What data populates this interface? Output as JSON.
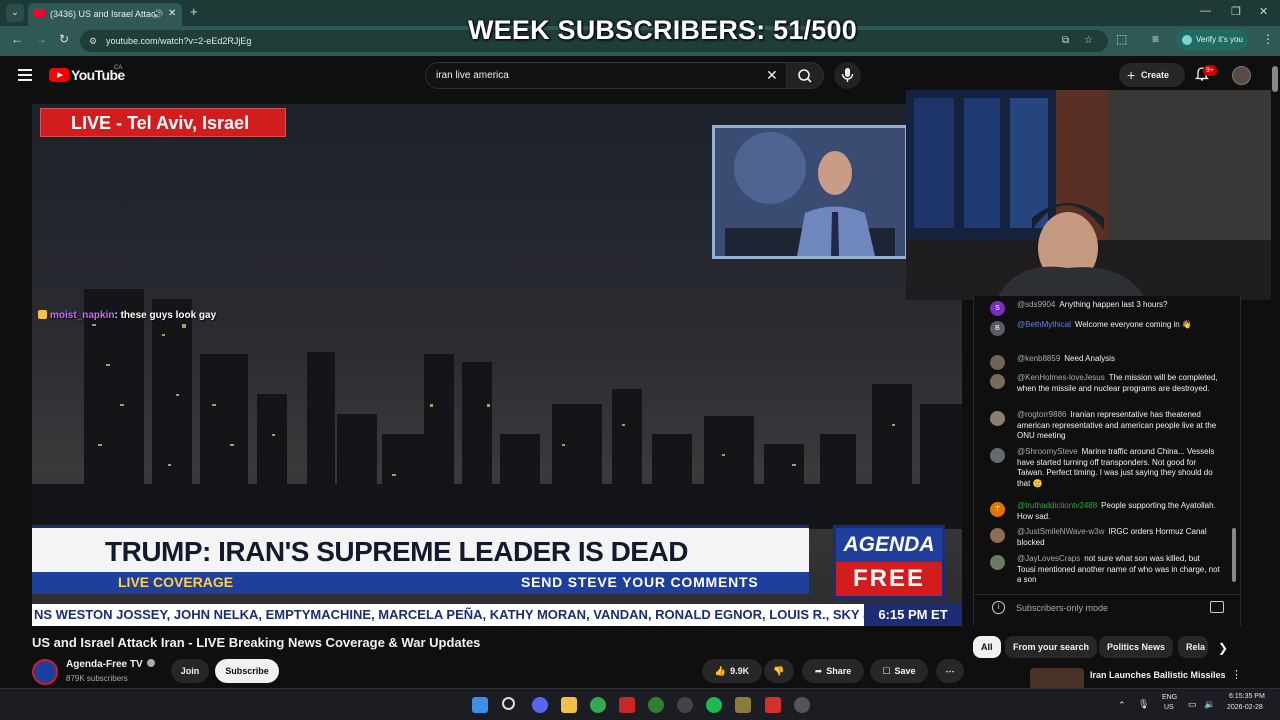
{
  "browser": {
    "tab_title": "(3436) US and Israel Attack",
    "url": "youtube.com/watch?v=2-eEd2RJjEg",
    "verify_label": "Verify it's you"
  },
  "overlay": {
    "week_subscribers": "WEEK SUBSCRIBERS: 51/500"
  },
  "youtube": {
    "wordmark": "YouTube",
    "country": "CA",
    "search_query": "iran live america",
    "create_label": "Create",
    "notif_count": "9+"
  },
  "video": {
    "live_banner": "LIVE - Tel Aviv, Israel",
    "stream_chat_user": "moist_napkin",
    "stream_chat_text": ": these guys look gay",
    "headline": "TRUMP: IRAN'S SUPREME LEADER IS DEAD",
    "sub_left": "LIVE COVERAGE",
    "sub_right": "SEND STEVE YOUR COMMENTS",
    "logo_top": "AGENDA",
    "logo_bottom": "FREE",
    "ticker": "NS WESTON JOSSEY, JOHN NELKA, EMPTYMACHINE, MARCELA PEÑA, KATHY MORAN, VANDAN, RONALD EGNOR, LOUIS R., SKY &",
    "ticker_time": "6:15 PM ET"
  },
  "meta": {
    "title": "US and Israel Attack Iran - LIVE Breaking News Coverage & War Updates",
    "channel": "Agenda-Free TV",
    "subscribers": "879K subscribers",
    "join": "Join",
    "subscribe": "Subscribe",
    "likes": "9.9K",
    "share": "Share",
    "save": "Save"
  },
  "chat": {
    "messages": [
      {
        "avatar": "S",
        "user": "@sds9904",
        "text": "Anything happen last 3 hours?"
      },
      {
        "avatar": "B",
        "user": "@BethMythical",
        "text": "Welcome everyone coming in 👋"
      },
      {
        "avatar": "",
        "user": "@kenb8859",
        "text": "Need Analysis"
      },
      {
        "avatar": "",
        "user": "@KenHolmes-loveJesus",
        "text": "The mission will be completed, when the missile and nuclear programs are destroyed."
      },
      {
        "avatar": "",
        "user": "@rogtorr9886",
        "text": "Iranian representative has theatened american representative and american people live at the ONU meeting"
      },
      {
        "avatar": "",
        "user": "@ShroomySteve",
        "text": "Marine traffic around China... Vessels have started turning off transponders. Not good for Taiwan. Perfect timing. I was just saying they should do that 🙂"
      },
      {
        "avatar": "T",
        "user": "@truthaddictiontv2488",
        "text": "People supporting the Ayatollah. How sad."
      },
      {
        "avatar": "",
        "user": "@JustSmileNWave-w3w",
        "text": "IRGC orders Hormuz Canal blocked"
      },
      {
        "avatar": "",
        "user": "@JayLovesCraps",
        "text": "not sure what son was killed, but Tousi mentioned another name of who was in charge, not a son"
      }
    ],
    "footer": "Subscribers-only mode"
  },
  "chips": [
    "All",
    "From your search",
    "Politics News",
    "Rela"
  ],
  "recommendation": {
    "title": "Iran Launches Ballistic Missiles"
  },
  "taskbar": {
    "lang": "ENG",
    "region": "US",
    "time": "6:15:35 PM",
    "date": "2026-02-28"
  },
  "colors": {
    "browser_toolbar": "#2f5a53",
    "youtube_red": "#ff0000",
    "agenda_blue": "#1f3f9c",
    "agenda_red": "#d11d1d"
  }
}
